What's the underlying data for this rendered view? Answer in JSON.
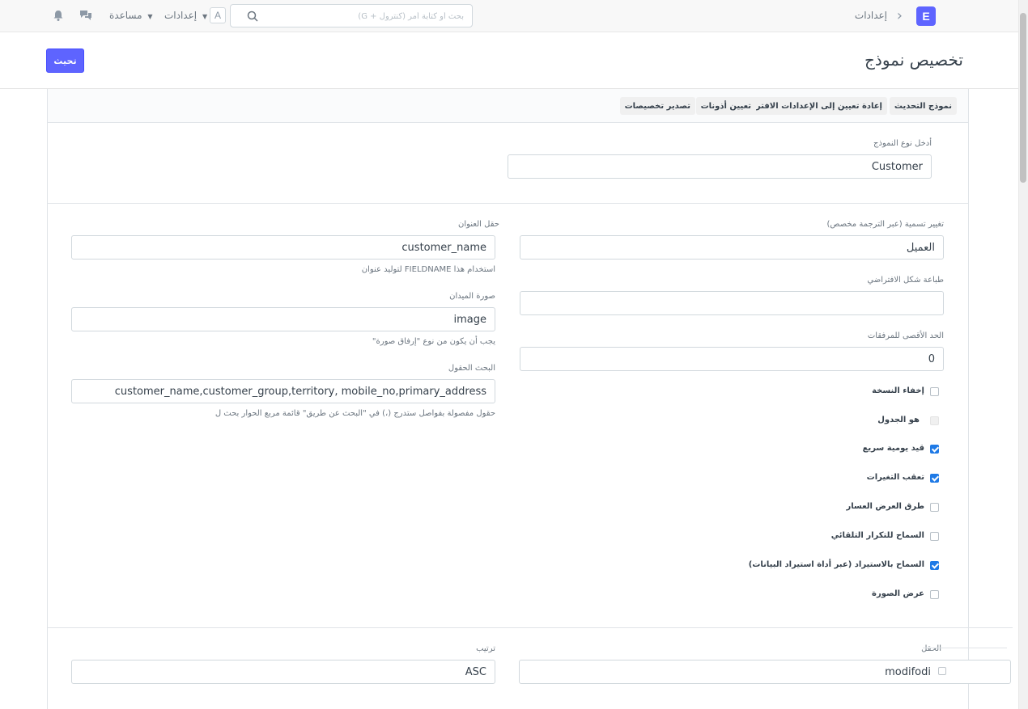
{
  "navbar": {
    "logo_letter": "E",
    "breadcrumb": "إعدادات",
    "search_placeholder": "بحث أو كتابة أمر (كنترول + G)",
    "avatar_letter": "A",
    "settings_menu": "إعدادات",
    "help_menu": "مساعدة"
  },
  "page": {
    "title": "تخصيص نموذج",
    "primary_button": "تحيث"
  },
  "toolbar": {
    "buttons": [
      "نموذج التحديث",
      "إعادة تعيين إلى الإعدادات الافتراضية",
      "تعيين أذونات",
      "تصدير تخصيصات"
    ]
  },
  "doctype_section": {
    "label": "أدخل نوع النموذج",
    "value": "Customer"
  },
  "right_column": {
    "label_rename": "تغيير تسمية (عبر الترجمة مخصص)",
    "value_rename": "العميل",
    "label_default_print": "طباعة شكل الافتراضي",
    "value_default_print": "",
    "label_max_attachments": "الحد الأقصى للمرفقات",
    "value_max_attachments": "0",
    "checkboxes": [
      {
        "label": "إخفاء النسخة",
        "checked": false,
        "disabled": false
      },
      {
        "label": "هو الجدول",
        "checked": false,
        "disabled": true
      },
      {
        "label": "قيد يومية سريع",
        "checked": true,
        "disabled": false
      },
      {
        "label": "تعقب التغيرات",
        "checked": true,
        "disabled": false
      },
      {
        "label": "طرق العرض العسار",
        "checked": false,
        "disabled": false
      },
      {
        "label": "السماح للتكرار التلقائي",
        "checked": false,
        "disabled": false
      },
      {
        "label": "السماح بالاستيراد (عبر أداة استيراد البيانات)",
        "checked": true,
        "disabled": false
      },
      {
        "label": "عرض الصورة",
        "checked": false,
        "disabled": false
      }
    ]
  },
  "left_column": {
    "label_title_field": "حقل العنوان",
    "value_title_field": "customer_name",
    "help_title_field": "استخدام هذا FIELDNAME لتوليد عنوان",
    "label_image_field": "صورة الميدان",
    "value_image_field": "image",
    "help_image_field": "يجب أن يكون من نوع \"إرفاق صورة\"",
    "label_search_fields": "البحث الحقول",
    "value_search_fields": "customer_name,customer_group,territory, mobile_no,primary_address",
    "help_search_fields": "حقول مفصولة بفواصل ستدرج (،) في \"البحث عن طريق\" قائمة مربع الحوار بحث ل"
  },
  "sort_section": {
    "label_field": "الحقل",
    "value_field": "modifodi",
    "label_order": "ترتيب",
    "value_order": "ASC"
  },
  "colors": {
    "primary": "#5e64ff",
    "checkbox_checked": "#1f7ae6"
  }
}
